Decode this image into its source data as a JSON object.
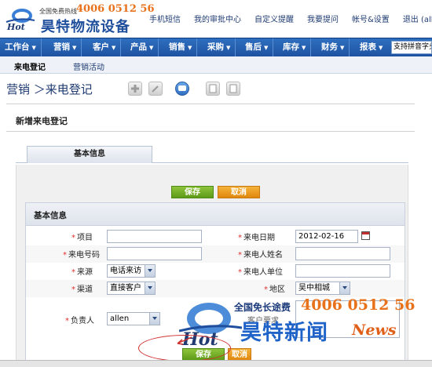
{
  "header": {
    "hotline_label": "全国免费热线",
    "hotline_number": "4006 0512 56",
    "company_name": "昊特物流设备",
    "top_links": [
      "手机短信",
      "我的审批中心",
      "自定义提醒",
      "我要提问",
      "帐号&设置",
      "退出 (allen"
    ]
  },
  "nav": {
    "items": [
      "工作台",
      "营销",
      "客户",
      "产品",
      "销售",
      "采购",
      "售后",
      "库存",
      "财务",
      "报表"
    ],
    "arrow": "▼",
    "search_value": "支持拼音字头"
  },
  "subnav": {
    "items": [
      "来电登记",
      "营销活动"
    ]
  },
  "page": {
    "breadcrumb": "营销 ＞来电登记"
  },
  "form": {
    "section_title": "新增来电登记",
    "tab_label": "基本信息",
    "group_title": "基本信息",
    "save_label": "保存",
    "cancel_label": "取消",
    "required_mark": "*",
    "fields": {
      "item_label": "项目",
      "phone_label": "来电号码",
      "source_label": "来源",
      "source_value": "电话来访",
      "channel_label": "渠道",
      "channel_value": "直接客户",
      "owner_label": "负责人",
      "owner_value": "allen",
      "date_label": "来电日期",
      "date_value": "2012-02-16",
      "caller_name_label": "来电人姓名",
      "caller_unit_label": "来电人单位",
      "region_label": "地区",
      "region_value": "吴中相城",
      "requirement_label": "客户要求"
    }
  },
  "watermark": {
    "hotline_label": "全国免长途费",
    "hotline_number": "4006 0512 56",
    "name_cn": "昊特新闻",
    "name_en": "News"
  },
  "colors": {
    "nav_bg": "#2f6fc0",
    "accent_orange": "#e8721c",
    "save_green": "#5d9a18",
    "cancel_orange": "#e0870e",
    "required_red": "#e03030"
  }
}
